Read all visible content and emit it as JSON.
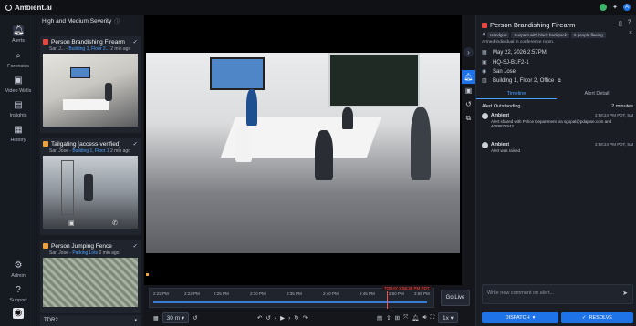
{
  "app": {
    "name": "Ambient.ai",
    "user_initial": "A"
  },
  "colors": {
    "accent": "#1e73e8",
    "critical": "#e8483f",
    "high": "#f0a33a",
    "link": "#4ea2ff",
    "warning": "#ff4d4d"
  },
  "rail": [
    {
      "label": "Alerts",
      "icon": "bell-icon"
    },
    {
      "label": "Forensics",
      "icon": "search-icon"
    },
    {
      "label": "Video Walls",
      "icon": "video-icon"
    },
    {
      "label": "Insights",
      "icon": "chart-icon"
    },
    {
      "label": "History",
      "icon": "history-icon"
    },
    {
      "label": "Admin",
      "icon": "gear-icon"
    },
    {
      "label": "Support",
      "icon": "help-icon"
    }
  ],
  "alerts": {
    "header": "High and Medium Severity",
    "cards": [
      {
        "title": "Person Brandishing Firearm",
        "site": "San J...",
        "location": "Building 1, Floor 2...",
        "age": "2 min ago"
      },
      {
        "title": "Tailgating [access-verified]",
        "site": "San Jose",
        "location": "Building 1, Floor 1",
        "age": "2 min ago"
      },
      {
        "title": "Person Jumping Fence",
        "site": "San Jose",
        "location": "Parking Lots",
        "age": "2 min ago"
      }
    ],
    "footer": "TDR2"
  },
  "timeline": {
    "ticks": [
      "2:22 PM",
      "2:25 PM",
      "2:30 PM",
      "2:35 PM",
      "2:40 PM",
      "2:45 PM",
      "2:50 PM",
      "2:55 PM"
    ],
    "now_label": "TODAY 2:58:38 PM PDT",
    "go_live": "Go Live",
    "range": "30 m",
    "speed": "1x"
  },
  "detail": {
    "title": "Person Brandishing Firearm",
    "tags": [
      "Handgun",
      "Suspect with black backpack",
      "5 people fleeing"
    ],
    "description": "Armed individual in conference room.",
    "date": "May 22, 2026 2:57PM",
    "camera": "HQ-SJ-B1F2-1",
    "site": "San Jose",
    "location": "Building 1, Floor 2, Office",
    "tabs": [
      "Timeline",
      "Alert Detail"
    ],
    "outstanding_label": "Alert Outstanding",
    "outstanding_value": "2 minutes",
    "entries": [
      {
        "who": "Ambient",
        "time": "2:58:24 PM PDT, Sat",
        "body": "Alert shared with Police Department via sgopal@pdajose.com and 4089876542"
      },
      {
        "who": "Ambient",
        "time": "2:58:24 PM PDT, Sat",
        "body": "Alert was raised"
      }
    ],
    "comment_placeholder": "Write new comment on alert...",
    "dispatch": "DISPATCH",
    "resolve": "RESOLVE"
  }
}
